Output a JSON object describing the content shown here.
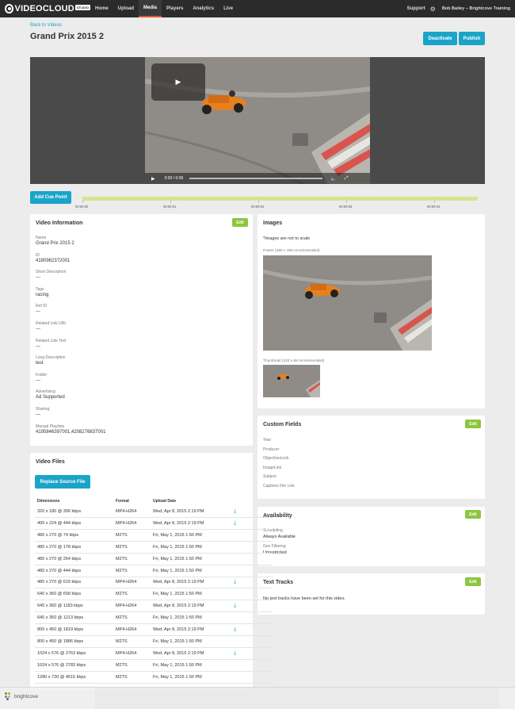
{
  "nav": {
    "logo_text": "VIDEOCLOUD",
    "logo_badge": "STUDIO",
    "items": [
      "Home",
      "Upload",
      "Media",
      "Players",
      "Analytics",
      "Live"
    ],
    "active": "Media",
    "support": "Support",
    "user": "Bob Bailey – Brightcove Training"
  },
  "header": {
    "back_link": "Back to Videos",
    "title": "Grand Prix 2015 2",
    "deactivate": "Deactivate",
    "publish": "Publish"
  },
  "player": {
    "time": "0:00 / 0:00"
  },
  "cue": {
    "button": "Add Cue Point",
    "labels": [
      "00:00:00",
      "00:00:01",
      "00:00:02",
      "00:00:03",
      "00:00:04"
    ]
  },
  "video_info": {
    "title": "Video Information",
    "edit": "Edit",
    "fields": [
      {
        "label": "Name",
        "value": "Grand Prix 2015 2"
      },
      {
        "label": "ID",
        "value": "4180962372001"
      },
      {
        "label": "Short Description",
        "value": "---"
      },
      {
        "label": "Tags",
        "value": "racing"
      },
      {
        "label": "Ref ID",
        "value": "---"
      },
      {
        "label": "Related Link URL",
        "value": "---"
      },
      {
        "label": "Related Link Text",
        "value": "---"
      },
      {
        "label": "Long Description",
        "value": "test"
      },
      {
        "label": "Folder",
        "value": "---"
      },
      {
        "label": "Advertising",
        "value": "Ad Supported"
      },
      {
        "label": "Sharing",
        "value": "---"
      },
      {
        "label": "Manual Playlists",
        "value": "4195846397001,4208276837001"
      }
    ]
  },
  "images": {
    "title": "Images",
    "note": "*Images are not to scale",
    "poster_caption": "Poster (480 x 360 recommended)",
    "thumb_caption": "Thumbnail (120 x 68 recommended)"
  },
  "custom_fields": {
    "title": "Custom Fields",
    "edit": "Edit",
    "items": [
      "Year",
      "Producer",
      "ObjectivesLink",
      "ImageLink",
      "Subject",
      "Captions File Link"
    ]
  },
  "availability": {
    "title": "Availability",
    "edit": "Edit",
    "scheduling_label": "Scheduling",
    "scheduling_value": "Always Available",
    "geo_label": "Geo Filtering",
    "geo_value": "Unrestricted"
  },
  "text_tracks": {
    "title": "Text Tracks",
    "edit": "Edit",
    "empty": "No text tracks have been set for this video."
  },
  "video_files": {
    "title": "Video Files",
    "replace": "Replace Source File",
    "columns": [
      "Dimensions",
      "Format",
      "Upload Date"
    ],
    "rows": [
      {
        "dim": "320 x 180 @ 306 kbps",
        "fmt": "MP4-H264",
        "date": "Wed, Apr 8, 2015 2:19 PM",
        "dl": true
      },
      {
        "dim": "400 x 224 @ 444 kbps",
        "fmt": "MP4-H264",
        "date": "Wed, Apr 8, 2015 2:19 PM",
        "dl": true
      },
      {
        "dim": "480 x 270 @ 74 kbps",
        "fmt": "M2TS",
        "date": "Fri, May 1, 2015 1:50 PM",
        "dl": false
      },
      {
        "dim": "480 x 270 @ 178 kbps",
        "fmt": "M2TS",
        "date": "Fri, May 1, 2015 1:50 PM",
        "dl": false
      },
      {
        "dim": "480 x 270 @ 264 kbps",
        "fmt": "M2TS",
        "date": "Fri, May 1, 2015 1:50 PM",
        "dl": false
      },
      {
        "dim": "480 x 270 @ 444 kbps",
        "fmt": "M2TS",
        "date": "Fri, May 1, 2015 1:50 PM",
        "dl": false
      },
      {
        "dim": "480 x 270 @ 619 kbps",
        "fmt": "MP4-H264",
        "date": "Wed, Apr 8, 2015 2:19 PM",
        "dl": true
      },
      {
        "dim": "640 x 360 @ 658 kbps",
        "fmt": "M2TS",
        "date": "Fri, May 1, 2015 1:50 PM",
        "dl": false
      },
      {
        "dim": "640 x 360 @ 1183 kbps",
        "fmt": "MP4-H264",
        "date": "Wed, Apr 8, 2015 2:19 PM",
        "dl": true
      },
      {
        "dim": "640 x 360 @ 1213 kbps",
        "fmt": "M2TS",
        "date": "Fri, May 1, 2015 1:50 PM",
        "dl": false
      },
      {
        "dim": "800 x 450 @ 1819 kbps",
        "fmt": "MP4-H264",
        "date": "Wed, Apr 8, 2015 2:19 PM",
        "dl": true
      },
      {
        "dim": "800 x 450 @ 1886 kbps",
        "fmt": "M2TS",
        "date": "Fri, May 1, 2015 1:50 PM",
        "dl": false
      },
      {
        "dim": "1024 x 576 @ 2763 kbps",
        "fmt": "MP4-H264",
        "date": "Wed, Apr 8, 2015 2:19 PM",
        "dl": true
      },
      {
        "dim": "1024 x 576 @ 2783 kbps",
        "fmt": "M2TS",
        "date": "Fri, May 1, 2015 1:50 PM",
        "dl": false
      },
      {
        "dim": "1280 x 720 @ 4615 kbps",
        "fmt": "M2TS",
        "date": "Fri, May 1, 2015 1:50 PM",
        "dl": false
      }
    ]
  },
  "footer": {
    "brand": "brightcove"
  },
  "colors": {
    "accent": "#1aa4c8",
    "edit_green": "#8dc63f",
    "nav_bg": "#2b2b2b",
    "active_underline": "#e5572b"
  }
}
